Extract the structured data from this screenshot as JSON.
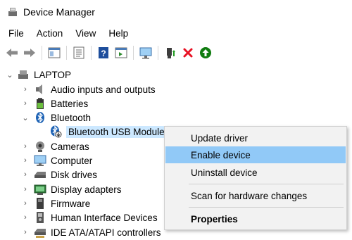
{
  "window": {
    "title": "Device Manager",
    "icon": "device-manager-icon"
  },
  "menu": [
    "File",
    "Action",
    "View",
    "Help"
  ],
  "toolbar": [
    {
      "icon": "back-arrow-icon"
    },
    {
      "icon": "forward-arrow-icon"
    },
    {
      "icon": "show-hide-tree-icon"
    },
    {
      "icon": "properties-sheet-icon"
    },
    {
      "icon": "help-icon"
    },
    {
      "icon": "action-pane-icon"
    },
    {
      "icon": "scan-hardware-icon"
    },
    {
      "icon": "update-driver-icon"
    },
    {
      "icon": "uninstall-x-icon",
      "color": "#e81123"
    },
    {
      "icon": "enable-device-icon",
      "color": "#107c10"
    }
  ],
  "tree": {
    "root": "LAPTOP",
    "items": [
      {
        "label": "Audio inputs and outputs",
        "icon": "speaker-icon",
        "state": "collapsed"
      },
      {
        "label": "Batteries",
        "icon": "battery-icon",
        "state": "collapsed"
      },
      {
        "label": "Bluetooth",
        "icon": "bluetooth-icon",
        "state": "expanded"
      },
      {
        "label": "Bluetooth USB Module",
        "icon": "bluetooth-disabled-icon",
        "state": "child",
        "selected": true
      },
      {
        "label": "Cameras",
        "icon": "camera-icon",
        "state": "collapsed"
      },
      {
        "label": "Computer",
        "icon": "computer-icon",
        "state": "collapsed"
      },
      {
        "label": "Disk drives",
        "icon": "disk-drive-icon",
        "state": "collapsed"
      },
      {
        "label": "Display adapters",
        "icon": "display-adapter-icon",
        "state": "collapsed"
      },
      {
        "label": "Firmware",
        "icon": "firmware-icon",
        "state": "collapsed"
      },
      {
        "label": "Human Interface Devices",
        "icon": "hid-icon",
        "state": "collapsed"
      },
      {
        "label": "IDE ATA/ATAPI controllers",
        "icon": "ide-controller-icon",
        "state": "collapsed"
      }
    ]
  },
  "context_menu": {
    "items": [
      "Update driver",
      "Enable device",
      "Uninstall device",
      "Scan for hardware changes",
      "Properties"
    ],
    "highlighted": "Enable device",
    "highlight_color": "#91c9f7"
  }
}
